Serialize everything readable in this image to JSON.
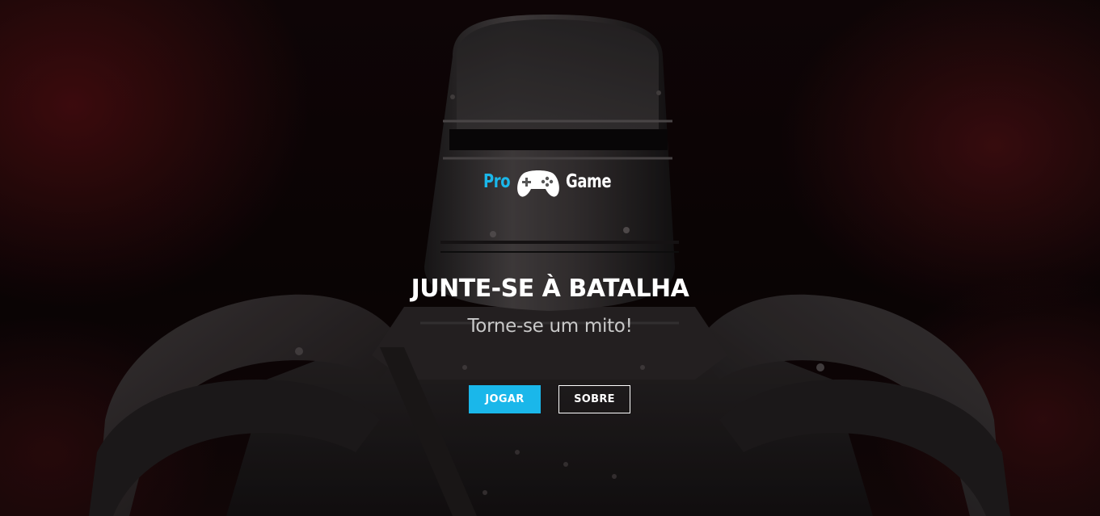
{
  "brand": {
    "logo_pro": "Pro",
    "logo_game": "Game",
    "icon": "gamepad-icon",
    "accent_color": "#1ab7ea"
  },
  "hero": {
    "headline": "JUNTE-SE À BATALHA",
    "subline": "Torne-se um mito!",
    "background": "armored-knight-image"
  },
  "actions": {
    "play_label": "JOGAR",
    "about_label": "SOBRE"
  }
}
